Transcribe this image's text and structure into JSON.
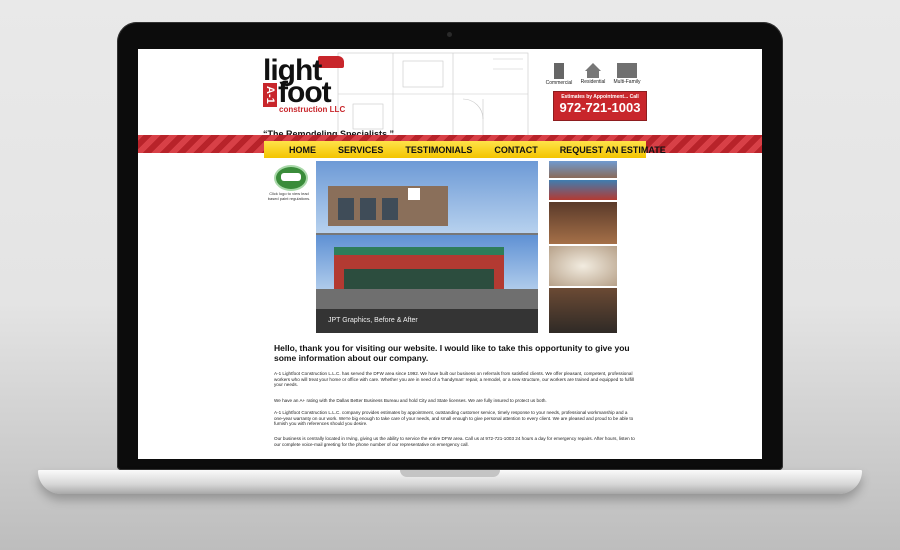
{
  "site": {
    "logo_line1": "light",
    "logo_line2": "foot",
    "logo_prefix": "A-1",
    "logo_line3": "construction LLC",
    "tagline": "“The Remodeling Specialists.”",
    "categories": [
      {
        "label": "Commercial",
        "icon": "office-building-icon"
      },
      {
        "label": "Residential",
        "icon": "house-icon"
      },
      {
        "label": "Multi-Family",
        "icon": "apartment-icon"
      }
    ],
    "estimate_note": "Estimates by Appointment... Call",
    "phone": "972-721-1003",
    "nav": [
      "HOME",
      "SERVICES",
      "TESTIMONIALS",
      "CONTACT",
      "REQUEST AN ESTIMATE"
    ],
    "epa_caption": "Click logo to view lead based paint regulations.",
    "photo_caption": "JPT Graphics, Before & After",
    "intro": "Hello, thank you for visiting our website. I would like to take this opportunity to give you some information about our company.",
    "paragraphs": [
      "A-1 Lightfoot Construction L.L.C. has served the DFW area since 1992. We have built our business on referrals from satisfied clients. We offer pleasant, competent, professional workers who will treat your home or office with care. Whether you are in need of a 'handyman' repair, a remodel, or a new structure, our workers are trained and equipped to fulfill your needs.",
      "We have an A+ rating with the Dallas Better Business Bureau and hold City and State licenses. We are fully insured to protect us both.",
      "A-1 Lightfoot Construction L.L.C. company provides estimates by appointment, outstanding customer service, timely response to your needs, professional workmanship and a one-year warranty on our work. We're big enough to take care of your needs, and small enough to give personal attention to every client. We are pleased and proud to be able to furnish you with references should you desire.",
      "Our business is centrally located in Irving, giving us the ability to service the entire DFW area. Call us at 972-721-1003 24 hours a day for emergency repairs. After hours, listen to our complete voice-mail greeting for the phone number of our representative on emergency call."
    ]
  },
  "colors": {
    "brand_red": "#c8262b",
    "nav_yellow": "#f3c400",
    "laptop_bezel": "#0c0c0c"
  }
}
